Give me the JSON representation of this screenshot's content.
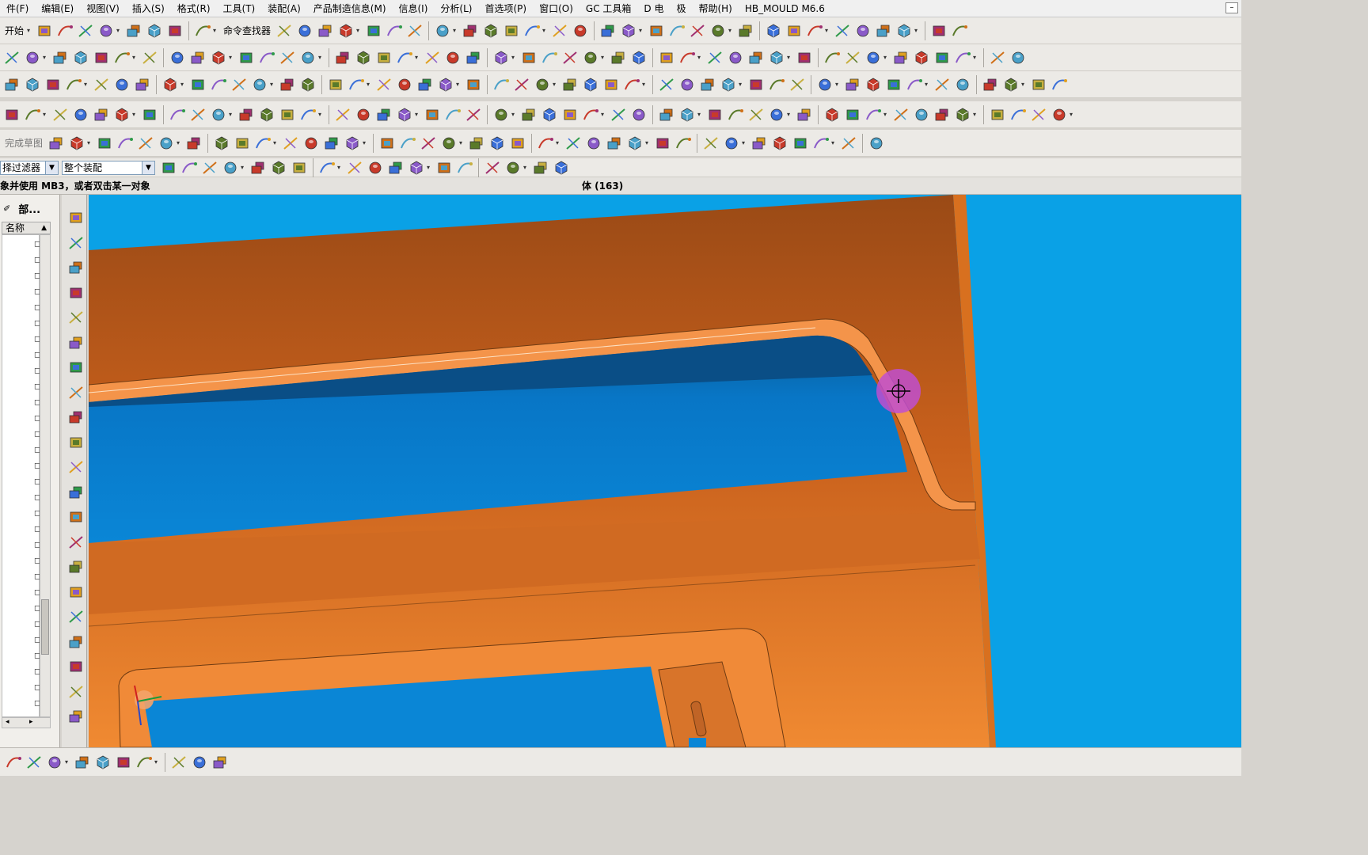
{
  "menu": {
    "items": [
      "件(F)",
      "编辑(E)",
      "视图(V)",
      "插入(S)",
      "格式(R)",
      "工具(T)",
      "装配(A)",
      "产品制造信息(M)",
      "信息(I)",
      "分析(L)",
      "首选项(P)",
      "窗口(O)",
      "GC 工具箱",
      "D 电",
      "极",
      "帮助(H)",
      "HB_MOULD M6.6"
    ]
  },
  "toolbar": {
    "start_label": "开始",
    "command_finder_label": "命令查找器",
    "sketch_label": "完成草图"
  },
  "filterbar": {
    "filter_label": "择过滤器",
    "assembly_scope": "整个装配"
  },
  "status": {
    "prompt": "象并使用 MB3，或者双击某一对象",
    "selection": "体 (163)"
  },
  "navigator": {
    "title": "部...",
    "column_name": "名称"
  },
  "colors": {
    "background": "#0aa1e6",
    "part_surface": "#e0731f",
    "part_shadow": "#a84f14",
    "selection_highlight": "#c04fd0"
  },
  "icons": {
    "toolbar1": [
      "new-icon",
      "open-icon",
      "save-icon",
      "cut-icon",
      "copy-icon",
      "paste-icon",
      "undo-icon",
      "redo-icon",
      "command-finder-icon",
      "layer-icon",
      "info-icon",
      "fit-icon",
      "shade-icon",
      "cube-icon",
      "flag-icon",
      "view-icon",
      "window-icon",
      "orient-icon",
      "snap-icon",
      "measure-icon",
      "ruler-icon",
      "curve-icon",
      "trim-icon",
      "offset-icon"
    ],
    "bottom": [
      "draft-icon",
      "dimension-icon",
      "note-icon",
      "table-icon",
      "view-create-icon",
      "section-icon",
      "annotate-icon",
      "text-icon",
      "text-style-icon",
      "font-icon"
    ]
  }
}
